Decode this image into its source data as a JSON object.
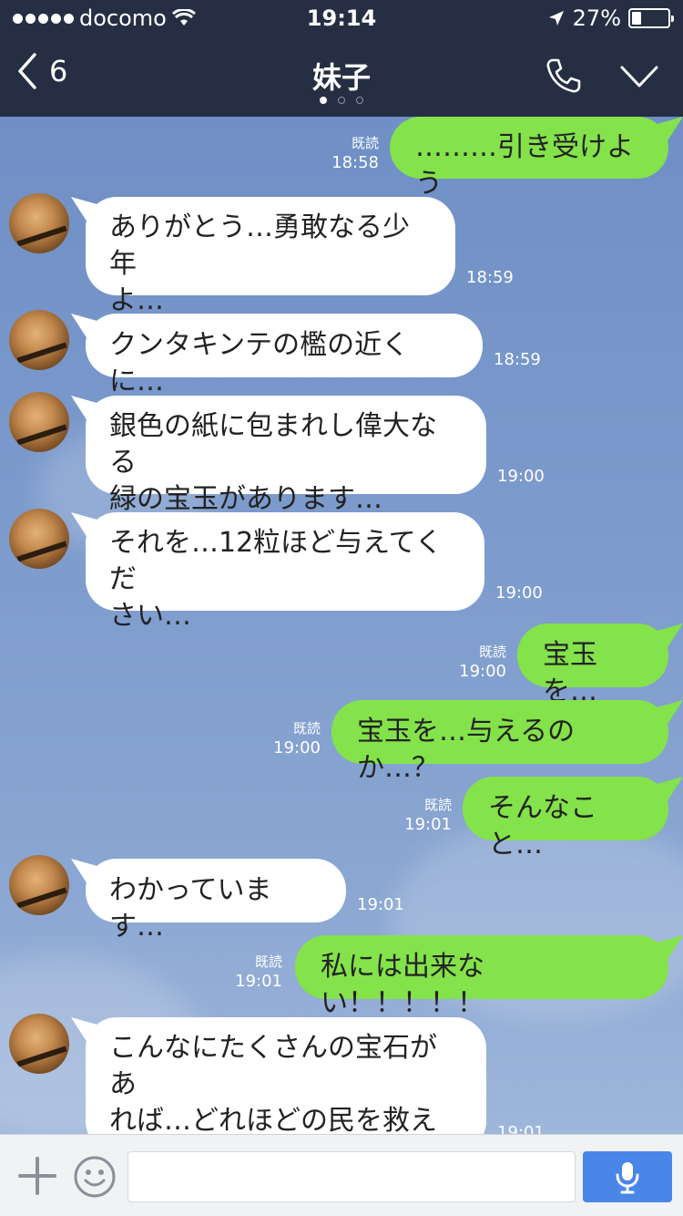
{
  "status_bar": {
    "carrier": "docomo",
    "time": "19:14",
    "battery_text": "27%",
    "battery_level": 0.27
  },
  "header": {
    "back_count": "6",
    "title": "妹子"
  },
  "messages": [
    {
      "side": "out",
      "text": "………引き受けよう",
      "read": "既読",
      "time": "18:58"
    },
    {
      "side": "in",
      "text": "ありがとう…勇敢なる少年\nよ…",
      "time": "18:59"
    },
    {
      "side": "in",
      "text": "クンタキンテの檻の近くに…",
      "time": "18:59"
    },
    {
      "side": "in",
      "text": "銀色の紙に包まれし偉大なる\n緑の宝玉があります…",
      "time": "19:00"
    },
    {
      "side": "in",
      "text": "それを…12粒ほど与えてくだ\nさい…",
      "time": "19:00"
    },
    {
      "side": "out",
      "text": "宝玉を…",
      "read": "既読",
      "time": "19:00"
    },
    {
      "side": "out",
      "text": "宝玉を…与えるのか…？",
      "read": "既読",
      "time": "19:00"
    },
    {
      "side": "out",
      "text": "そんなこと…",
      "read": "既読",
      "time": "19:01"
    },
    {
      "side": "in",
      "text": "わかっています…",
      "time": "19:01"
    },
    {
      "side": "out",
      "text": "私には出来ない！！！！！",
      "read": "既読",
      "time": "19:01"
    },
    {
      "side": "in",
      "text": "こんなにたくさんの宝石があ\nれば…どれほどの民を救える\nか…",
      "time": "19:01"
    }
  ],
  "input": {
    "placeholder": "",
    "value": ""
  },
  "icons": {
    "back": "chevron-left-icon",
    "call": "phone-icon",
    "menu": "chevron-down-icon",
    "add": "plus-icon",
    "sticker": "smiley-icon",
    "voice": "microphone-icon"
  },
  "colors": {
    "header_bg": "#252e42",
    "outgoing_bubble": "#84e24a",
    "incoming_bubble": "#ffffff",
    "mic_button": "#4a86e8"
  }
}
